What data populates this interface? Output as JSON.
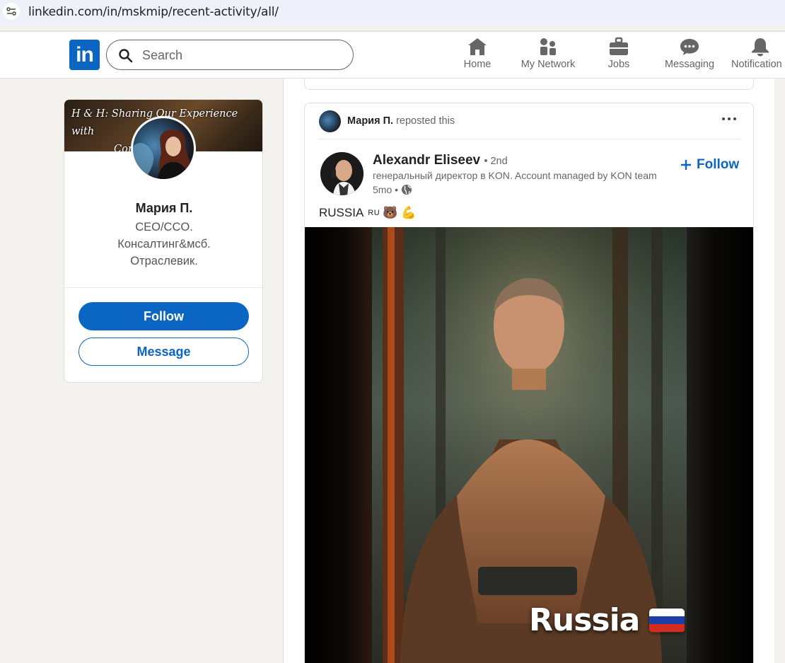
{
  "browser": {
    "url": "linkedin.com/in/mskmip/recent-activity/all/"
  },
  "header": {
    "logo_text": "in",
    "search_placeholder": "Search",
    "nav": [
      {
        "label": "Home",
        "icon": "home-icon"
      },
      {
        "label": "My Network",
        "icon": "network-icon"
      },
      {
        "label": "Jobs",
        "icon": "briefcase-icon"
      },
      {
        "label": "Messaging",
        "icon": "messaging-icon"
      },
      {
        "label": "Notification",
        "icon": "bell-icon"
      }
    ]
  },
  "profile": {
    "banner_line1": "H & H: Sharing Our Experience with",
    "banner_line2": "Com              People",
    "name": "Мария П.",
    "headline_line1": "CEO/CCO.",
    "headline_line2": "Консалтинг&мсб.",
    "headline_line3": "Отраслевик.",
    "follow_label": "Follow",
    "message_label": "Message"
  },
  "post": {
    "reposter_name": "Мария П.",
    "repost_suffix": "reposted this",
    "author_name": "Alexandr Eliseev",
    "author_degree": "• 2nd",
    "author_headline": "генеральный директор в KON. Account managed by KON team",
    "time": "5mo •",
    "follow_label": "Follow",
    "text": "RUSSIA",
    "text_flag": "RU",
    "text_emoji": "🐻 💪",
    "media_caption": "Russia"
  },
  "colors": {
    "brand": "#0a66c2",
    "flag_white": "#ffffff",
    "flag_blue": "#1c3fa8",
    "flag_red": "#d52b1e"
  }
}
